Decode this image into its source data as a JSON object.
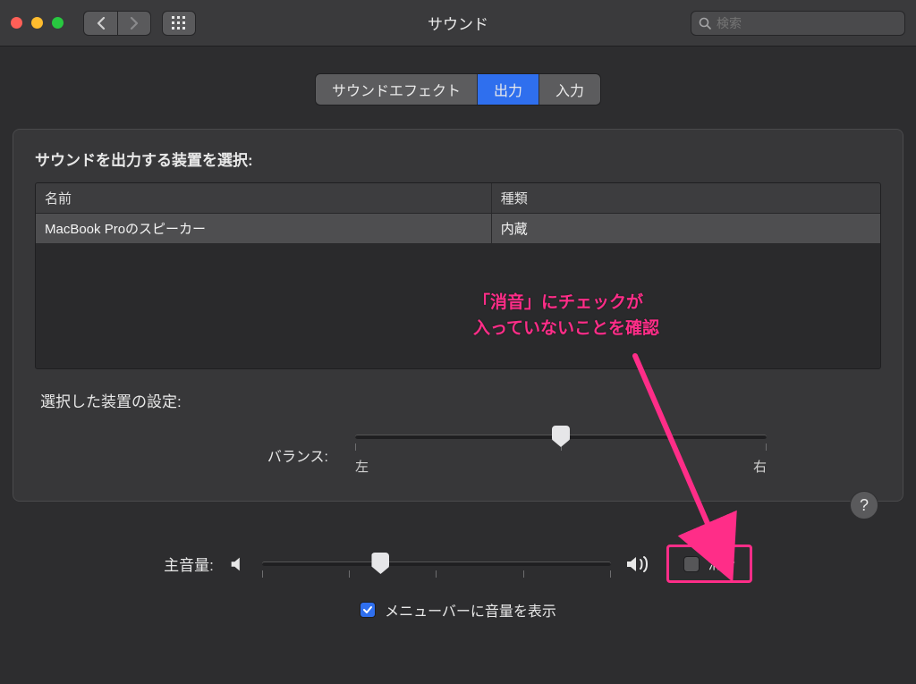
{
  "window": {
    "title": "サウンド",
    "search_placeholder": "検索"
  },
  "tabs": {
    "effects": "サウンドエフェクト",
    "output": "出力",
    "input": "入力"
  },
  "output": {
    "select_device_label": "サウンドを出力する装置を選択:",
    "columns": {
      "name": "名前",
      "kind": "種類"
    },
    "devices": [
      {
        "name": "MacBook Proのスピーカー",
        "kind": "内蔵"
      }
    ],
    "selected_settings_label": "選択した装置の設定:",
    "balance": {
      "label": "バランス:",
      "left": "左",
      "right": "右",
      "value_percent": 50
    }
  },
  "volume": {
    "label": "主音量:",
    "value_percent": 34,
    "mute_label": "消音",
    "mute_checked": false,
    "menubar_label": "メニューバーに音量を表示",
    "menubar_checked": true
  },
  "help": "?",
  "annotation": {
    "line1": "「消音」にチェックが",
    "line2": "入っていないことを確認"
  }
}
